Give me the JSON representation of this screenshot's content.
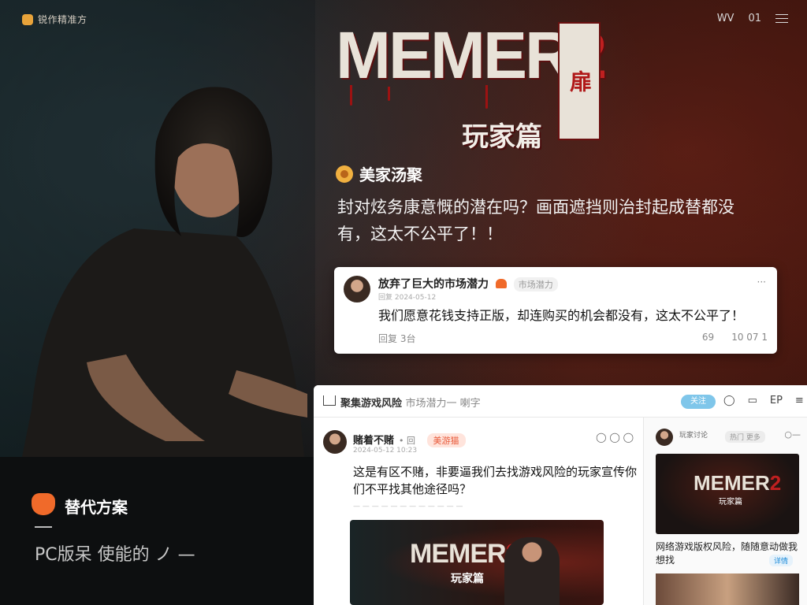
{
  "brand": {
    "name": "锐作精准方"
  },
  "nav": {
    "item1": "WV",
    "item2": "01"
  },
  "logo": {
    "title": "MEMER",
    "number": "2",
    "badge": "扉",
    "subtitle": "玩家篇"
  },
  "hero": {
    "tag_label": "美家汤聚",
    "quote": "封对炫务康意慨的潜在吗？画面遮挡则治封起成替都没有，这太不公平了！！"
  },
  "top_card": {
    "name": "放弃了巨大的市场潜力",
    "chip": "市场潜力",
    "meta": "回复 2024-05-12",
    "text": "我们愿意花钱支持正版，却连购买的机会都没有，这太不公平了！",
    "footer": "回复 3台",
    "stat_a": "69",
    "stat_b": "10 07 1",
    "more": "···"
  },
  "panel": {
    "title": "聚集游戏风险",
    "title_sub": "市场潜力一 喇字",
    "pill": "关注",
    "icons": [
      "◯",
      "▭",
      "EP",
      "≡"
    ],
    "feed": {
      "name": "赌着不赌",
      "id": "• 回",
      "tag": "美游猫",
      "meta": "2024-05-12 10:23",
      "actions": "◯ ◯ ◯",
      "text": "这是有区不赌，非要逼我们去找游戏风险的玩家宣传你们不平找其他途径吗？",
      "separator": "— — — — — — — — — — — —",
      "image_logo": "MEMER",
      "image_logo_num": "2",
      "image_sub": "玩家篇"
    },
    "side": {
      "name": "玩家讨论",
      "chip": "热门 更多",
      "more": "○—",
      "image_logo": "MEMER",
      "image_logo_num": "2",
      "image_sub": "玩家篇",
      "text": "网络游戏版权风险，随随意动做我想找",
      "pill": "详情"
    }
  },
  "bottom_left": {
    "alt_title": "替代方案",
    "pc_line": "PC版呆 使能的 ノ —"
  }
}
